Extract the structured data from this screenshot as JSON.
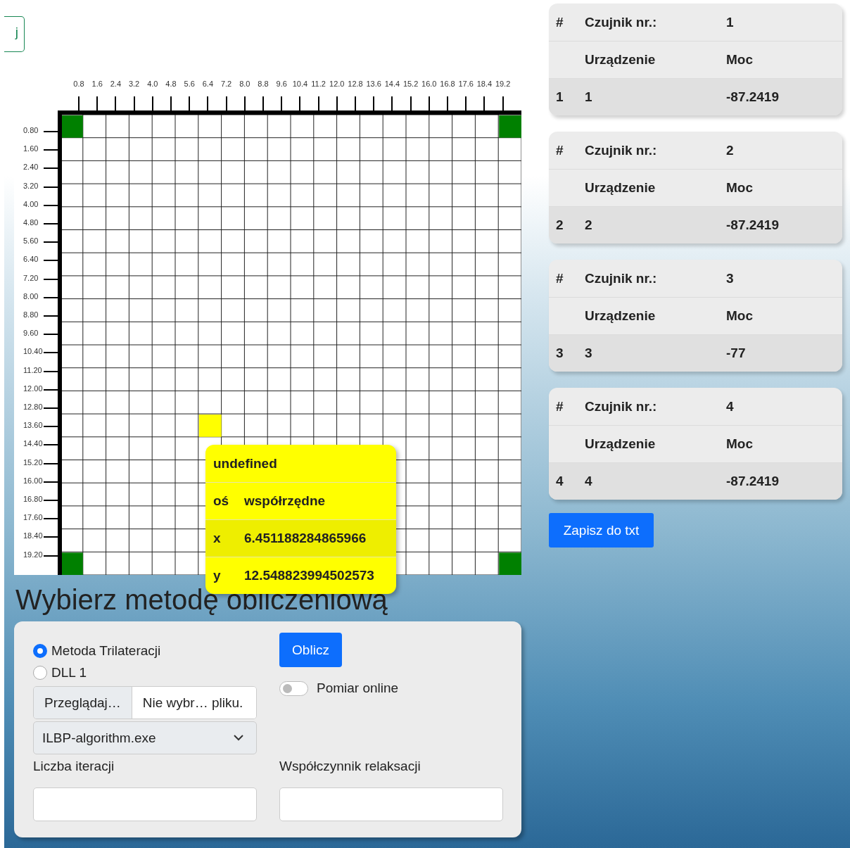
{
  "top_button": {
    "label": "j"
  },
  "chart": {
    "x_labels": [
      "0.8",
      "1.6",
      "2.4",
      "3.2",
      "4.0",
      "4.8",
      "5.6",
      "6.4",
      "7.2",
      "8.0",
      "8.8",
      "9.6",
      "10.4",
      "11.2",
      "12.0",
      "12.8",
      "13.6",
      "14.4",
      "15.2",
      "16.0",
      "16.8",
      "17.6",
      "18.4",
      "19.2"
    ],
    "y_labels": [
      "0.80",
      "1.60",
      "2.40",
      "3.20",
      "4.00",
      "4.80",
      "5.60",
      "6.40",
      "7.20",
      "8.00",
      "8.80",
      "9.60",
      "10.40",
      "11.20",
      "12.00",
      "12.80",
      "13.60",
      "14.40",
      "15.20",
      "16.00",
      "16.80",
      "17.60",
      "18.40",
      "19.20"
    ],
    "markers": [
      {
        "kind": "anchor",
        "color": "#008000"
      },
      {
        "kind": "anchor",
        "color": "#008000"
      },
      {
        "kind": "anchor",
        "color": "#008000"
      },
      {
        "kind": "anchor",
        "color": "#008000"
      },
      {
        "kind": "estimate",
        "color": "#ffff00"
      }
    ]
  },
  "tooltip": {
    "title": "undefined",
    "header": [
      "oś",
      "współrzędne"
    ],
    "rows": [
      {
        "axis": "x",
        "value": "6.451188284865966"
      },
      {
        "axis": "y",
        "value": "12.548823994502573"
      }
    ]
  },
  "heading": "Wybierz metodę obliczeniową",
  "method": {
    "radios": [
      {
        "label": "Metoda Trilateracji",
        "selected": true
      },
      {
        "label": "DLL 1",
        "selected": false
      }
    ],
    "file_button": "Przeglądaj…",
    "file_name": "Nie wybr… pliku.",
    "select_value": "ILBP-algorithm.exe",
    "compute_button": "Oblicz",
    "toggle": {
      "label": "Pomiar online",
      "on": false
    },
    "fields": [
      {
        "label": "Liczba iteracji"
      },
      {
        "label": "Współczynnik relaksacji"
      }
    ]
  },
  "sensors": [
    {
      "header": [
        "#",
        "Czujnik nr.:",
        "1"
      ],
      "subheader": [
        "Urządzenie",
        "Moc"
      ],
      "row": [
        "1",
        "1",
        "-87.2419"
      ]
    },
    {
      "header": [
        "#",
        "Czujnik nr.:",
        "2"
      ],
      "subheader": [
        "Urządzenie",
        "Moc"
      ],
      "row": [
        "2",
        "2",
        "-87.2419"
      ]
    },
    {
      "header": [
        "#",
        "Czujnik nr.:",
        "3"
      ],
      "subheader": [
        "Urządzenie",
        "Moc"
      ],
      "row": [
        "3",
        "3",
        "-77"
      ]
    },
    {
      "header": [
        "#",
        "Czujnik nr.:",
        "4"
      ],
      "subheader": [
        "Urządzenie",
        "Moc"
      ],
      "row": [
        "4",
        "4",
        "-87.2419"
      ]
    }
  ],
  "save_button": "Zapisz do txt"
}
